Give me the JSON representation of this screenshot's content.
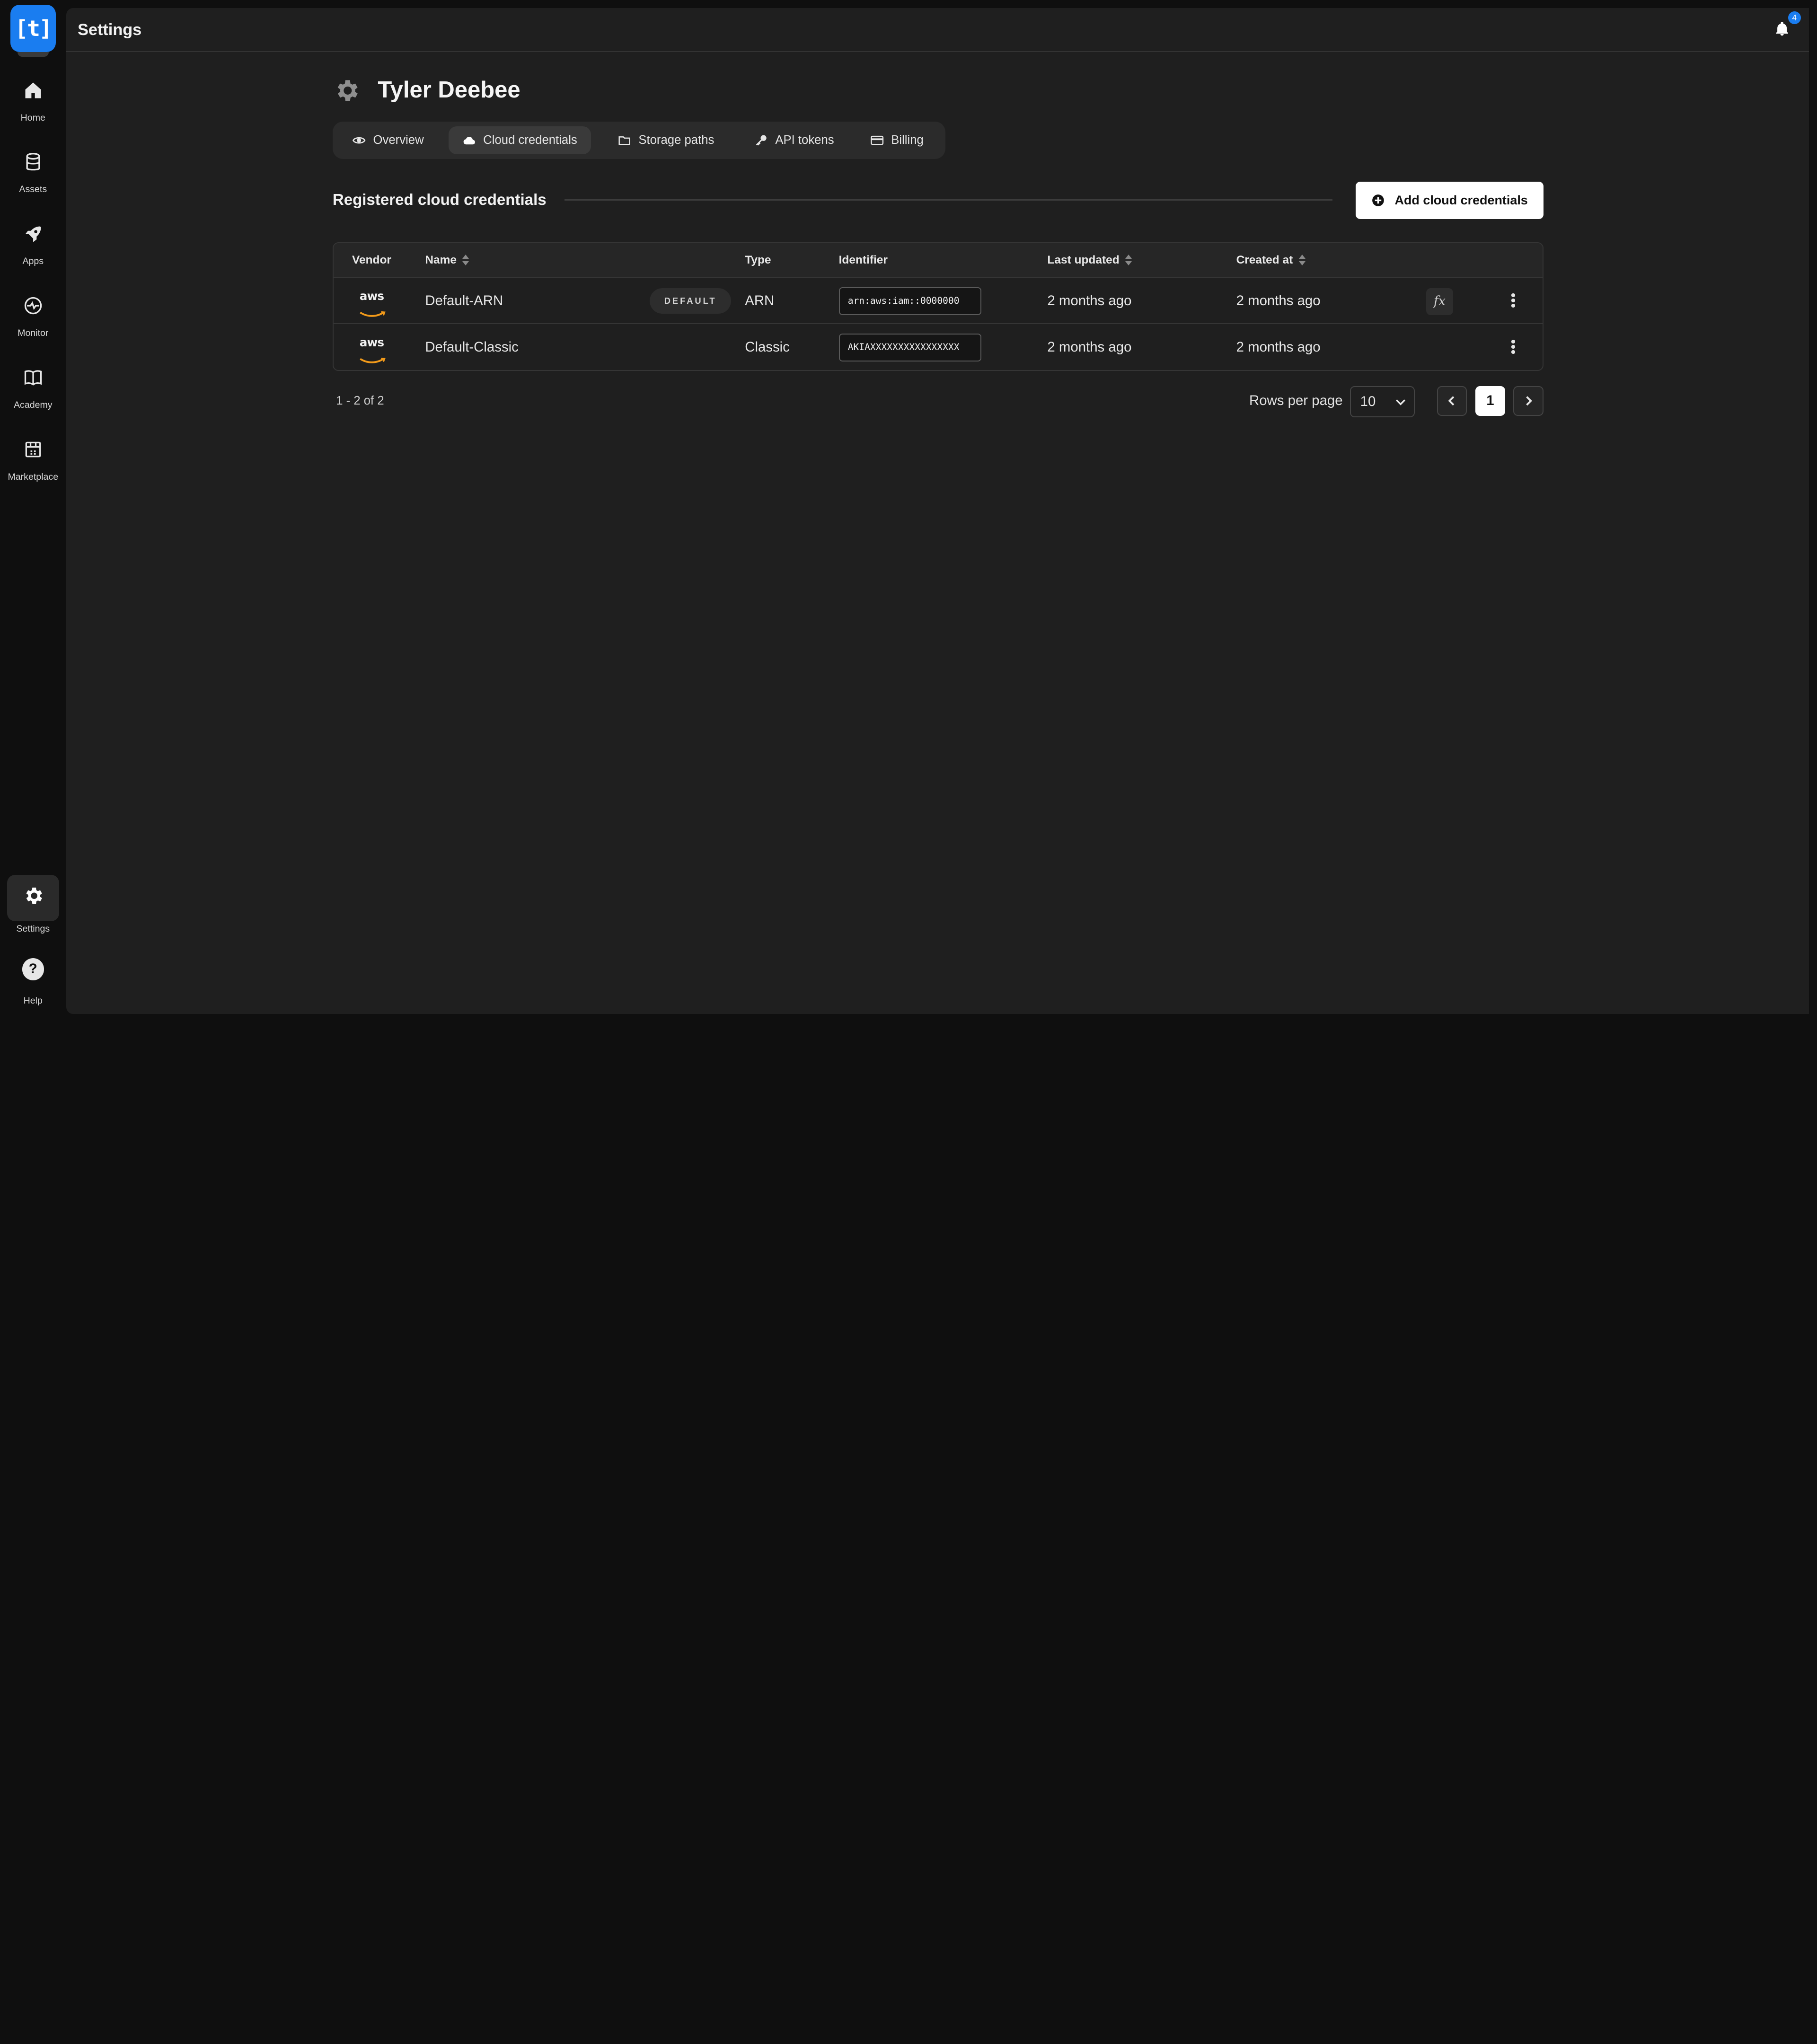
{
  "app": {
    "logo_text": "[t]",
    "brand_color": "#1a7df0"
  },
  "nav": {
    "items": [
      {
        "label": "Home",
        "icon": "home-icon"
      },
      {
        "label": "Assets",
        "icon": "database-icon"
      },
      {
        "label": "Apps",
        "icon": "rocket-icon"
      },
      {
        "label": "Monitor",
        "icon": "pulse-icon"
      },
      {
        "label": "Academy",
        "icon": "book-icon"
      },
      {
        "label": "Marketplace",
        "icon": "store-icon"
      }
    ],
    "settings_label": "Settings",
    "help_label": "Help"
  },
  "topbar": {
    "title": "Settings",
    "notification_count": "4"
  },
  "profile": {
    "name": "Tyler Deebee"
  },
  "tabs": [
    {
      "label": "Overview",
      "icon": "eye-icon",
      "active": false
    },
    {
      "label": "Cloud credentials",
      "icon": "cloud-icon",
      "active": true
    },
    {
      "label": "Storage paths",
      "icon": "folder-icon",
      "active": false
    },
    {
      "label": "API tokens",
      "icon": "key-icon",
      "active": false
    },
    {
      "label": "Billing",
      "icon": "card-icon",
      "active": false
    }
  ],
  "section": {
    "title": "Registered cloud credentials",
    "add_button_label": "Add cloud credentials"
  },
  "table": {
    "columns": [
      "Vendor",
      "Name",
      "Type",
      "Identifier",
      "Last updated",
      "Created at"
    ],
    "rows": [
      {
        "vendor": "aws",
        "name": "Default-ARN",
        "badge": "DEFAULT",
        "type": "ARN",
        "identifier": "arn:aws:iam::0000000",
        "last_updated": "2 months ago",
        "created_at": "2 months ago",
        "fx": "fx"
      },
      {
        "vendor": "aws",
        "name": "Default-Classic",
        "badge": "",
        "type": "Classic",
        "identifier": "AKIAXXXXXXXXXXXXXXXX",
        "last_updated": "2 months ago",
        "created_at": "2 months ago"
      }
    ]
  },
  "pagination": {
    "range_text": "1 - 2 of 2",
    "rows_per_page_label": "Rows per page",
    "rows_per_page_value": "10",
    "current_page": "1"
  }
}
